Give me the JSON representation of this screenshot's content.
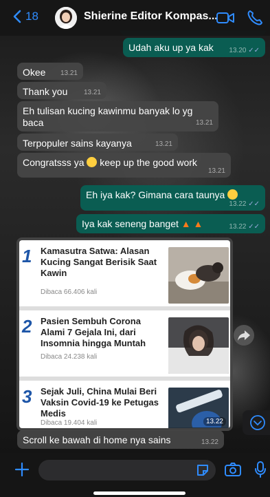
{
  "header": {
    "back_count": "18",
    "contact_name": "Shierine Editor Kompas..."
  },
  "messages": [
    {
      "text": "Udah aku up ya kak",
      "time": "13.20",
      "dir": "out"
    },
    {
      "text": "Okee",
      "time": "13.21",
      "dir": "in"
    },
    {
      "text": "Thank you",
      "time": "13.21",
      "dir": "in"
    },
    {
      "text": "Eh tulisan kucing kawinmu banyak lo yg",
      "text2": "baca",
      "time": "13.21",
      "dir": "in"
    },
    {
      "text": "Terpopuler sains kayanya",
      "time": "13.21",
      "dir": "in"
    },
    {
      "text": "Congratsss ya",
      "text2": "keep up the good work",
      "time": "13.21",
      "dir": "in"
    },
    {
      "text": "Eh iya kak? Gimana cara taunya",
      "time": "13.22",
      "dir": "out"
    },
    {
      "text": "Iya kak seneng banget",
      "time": "13.22",
      "dir": "out"
    },
    {
      "text": "Scroll ke bawah di home nya sains",
      "time": "13.22",
      "dir": "in"
    }
  ],
  "image_card": {
    "time": "13.22",
    "articles": [
      {
        "rank": "1",
        "title": "Kamasutra Satwa: Alasan Kucing Sangat Berisik Saat Kawin",
        "views": "Dibaca 66.406 kali"
      },
      {
        "rank": "2",
        "title": "Pasien Sembuh Corona Alami 7 Gejala Ini, dari Insomnia hingga Muntah",
        "views": "Dibaca 24.238 kali"
      },
      {
        "rank": "3",
        "title": "Sejak Juli, China Mulai Beri Vaksin Covid-19 ke Petugas Medis",
        "views": "Dibaca 19.404 kali"
      }
    ]
  },
  "colors": {
    "accent": "#2f8cff",
    "outgoing": "#0a5d52",
    "incoming": "#464646",
    "rank": "#1e56a8"
  },
  "icons": [
    "chevron-left-icon",
    "video-call-icon",
    "phone-icon",
    "plus-icon",
    "sticker-icon",
    "camera-icon",
    "microphone-icon",
    "forward-icon",
    "scroll-down-icon"
  ]
}
